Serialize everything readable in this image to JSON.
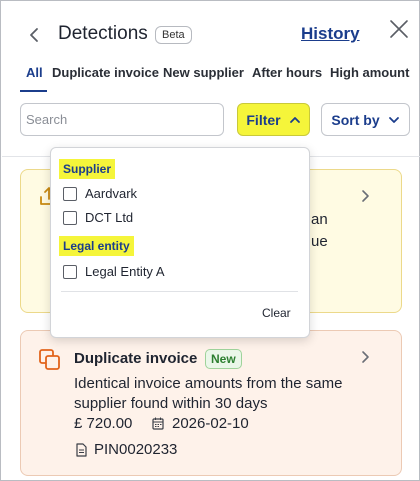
{
  "header": {
    "title": "Detections",
    "badge": "Beta",
    "history_link": "History"
  },
  "tabs": [
    {
      "label": "All",
      "active": true
    },
    {
      "label": "Duplicate invoice"
    },
    {
      "label": "New supplier"
    },
    {
      "label": "After hours"
    },
    {
      "label": "High amount"
    }
  ],
  "search": {
    "placeholder": "Search",
    "value": ""
  },
  "filter": {
    "label": "Filter",
    "expanded": true
  },
  "sort": {
    "label": "Sort by"
  },
  "filter_menu": {
    "groups": [
      {
        "label": "Supplier",
        "options": [
          "Aardvark",
          "DCT Ltd"
        ]
      },
      {
        "label": "Legal entity",
        "options": [
          "Legal Entity A"
        ]
      }
    ],
    "clear_label": "Clear"
  },
  "cards": [
    {
      "type_icon": "upload-tray-icon",
      "partial_lines": [
        "an",
        "ue"
      ]
    },
    {
      "type_icon": "duplicate-icon",
      "title": "Duplicate invoice",
      "badge": "New",
      "description": "Identical invoice amounts from the same supplier found within 30 days",
      "amount": "£ 720.00",
      "date": "2026-02-10",
      "reference": "PIN0020233"
    }
  ],
  "colors": {
    "accent": "#1b3d8c",
    "highlight": "#f5f53a",
    "card_warning_bg": "#fffbe3",
    "card_duplicate_bg": "#fef2ea",
    "new_badge": "#2d7f30"
  }
}
